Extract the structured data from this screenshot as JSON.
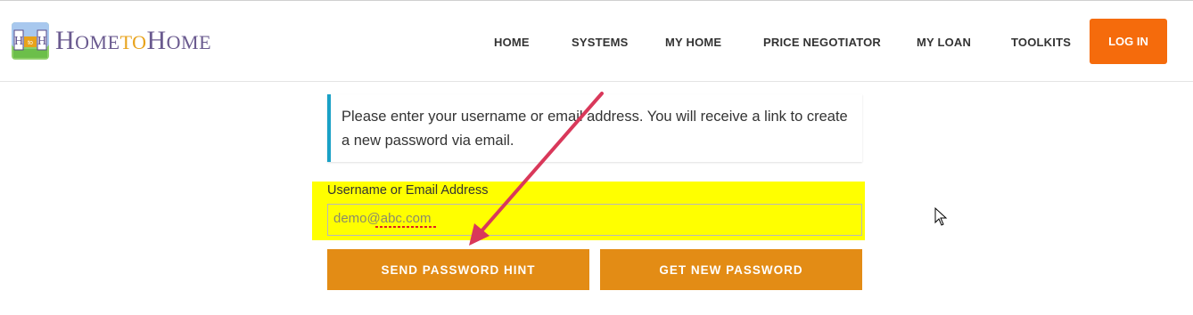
{
  "brand": {
    "home1": "Home",
    "to": "to",
    "home2": "Home",
    "badge": "HtoH"
  },
  "nav": [
    {
      "label": "HOME"
    },
    {
      "label": "SYSTEMS"
    },
    {
      "label": "MY HOME"
    },
    {
      "label": "PRICE NEGOTIATOR"
    },
    {
      "label": "MY LOAN"
    },
    {
      "label": "TOOLKITS"
    }
  ],
  "login": {
    "label": "LOG IN"
  },
  "message": "Please enter your username or email address. You will receive a link to create a new password via email.",
  "form": {
    "label": "Username or Email Address",
    "value": "demo@abc.com"
  },
  "buttons": {
    "hint": "SEND PASSWORD HINT",
    "new_password": "GET NEW PASSWORD"
  },
  "colors": {
    "accent_orange": "#f56b0c",
    "button_orange": "#e38c15",
    "highlight": "#ffff00",
    "info_border": "#1aa1c6",
    "annotation_arrow": "#d9385a"
  },
  "icons": {
    "logo": "house-logo-icon",
    "arrow": "annotation-arrow-icon",
    "cursor": "mouse-cursor-icon"
  }
}
